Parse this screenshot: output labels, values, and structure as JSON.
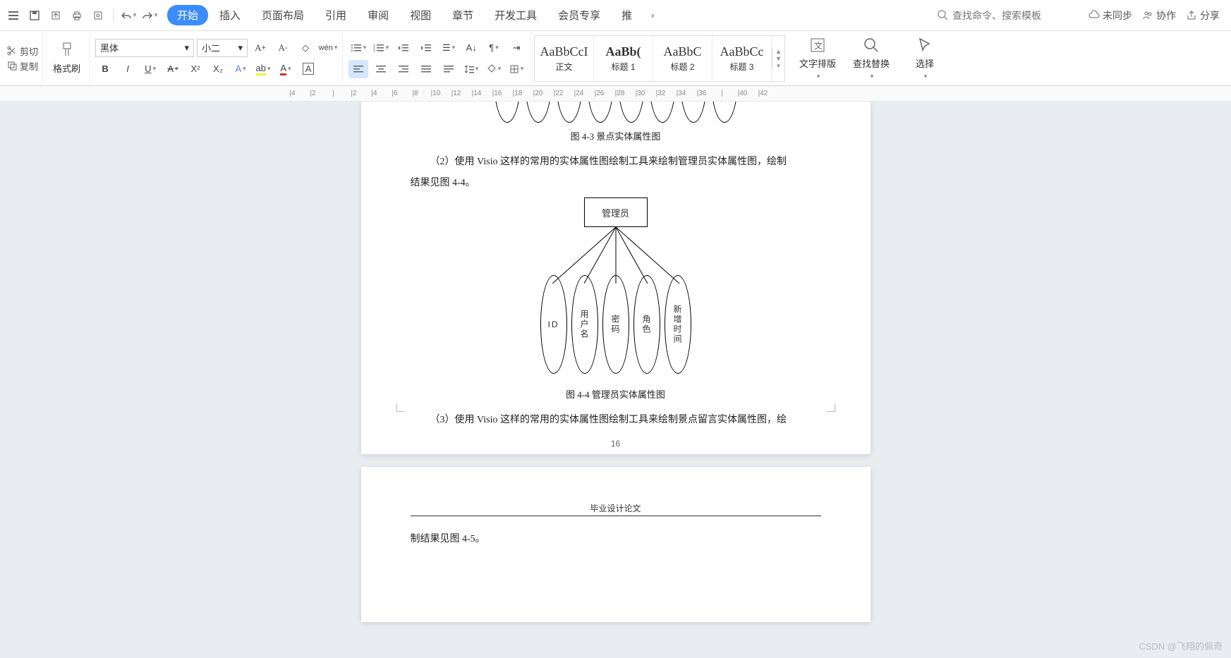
{
  "menubar": {
    "tabs": [
      "开始",
      "插入",
      "页面布局",
      "引用",
      "审阅",
      "视图",
      "章节",
      "开发工具",
      "会员专享",
      "推"
    ],
    "active_tab": "开始",
    "search_placeholder": "查找命令、搜索模板",
    "sync": "未同步",
    "coop": "协作",
    "share": "分享"
  },
  "clipboard": {
    "cut": "剪切",
    "copy": "复制",
    "brush": "格式刷"
  },
  "font": {
    "name": "黑体",
    "size": "小二"
  },
  "styles": [
    {
      "preview": "AaBbCcI",
      "name": "正文"
    },
    {
      "preview": "AaBb(",
      "name": "标题 1"
    },
    {
      "preview": "AaBbC",
      "name": "标题 2"
    },
    {
      "preview": "AaBbCc",
      "name": "标题 3"
    }
  ],
  "bigbtns": {
    "layout": "文字排版",
    "find": "查找替换",
    "select": "选择"
  },
  "ruler": [
    "4",
    "2",
    "",
    "2",
    "4",
    "6",
    "8",
    "10",
    "12",
    "14",
    "16",
    "18",
    "20",
    "22",
    "24",
    "26",
    "28",
    "30",
    "32",
    "34",
    "36",
    "",
    "40",
    "42"
  ],
  "doc": {
    "caption43": "图 4-3 景点实体属性图",
    "para2": "（2）使用 Visio 这样的常用的实体属性图绘制工具来绘制管理员实体属性图，绘制",
    "para2b": "结果见图 4-4。",
    "entity_box": "管理员",
    "attrs": [
      "ID",
      "用户名",
      "密码",
      "角色",
      "新增时间"
    ],
    "caption44": "图 4-4 管理员实体属性图",
    "para3": "（3）使用 Visio 这样的常用的实体属性图绘制工具来绘制景点留言实体属性图，绘",
    "pagenum": "16",
    "header2": "毕业设计论文",
    "para3b": "制结果见图 4-5。"
  },
  "watermark": "CSDN @飞翔的佩奇"
}
